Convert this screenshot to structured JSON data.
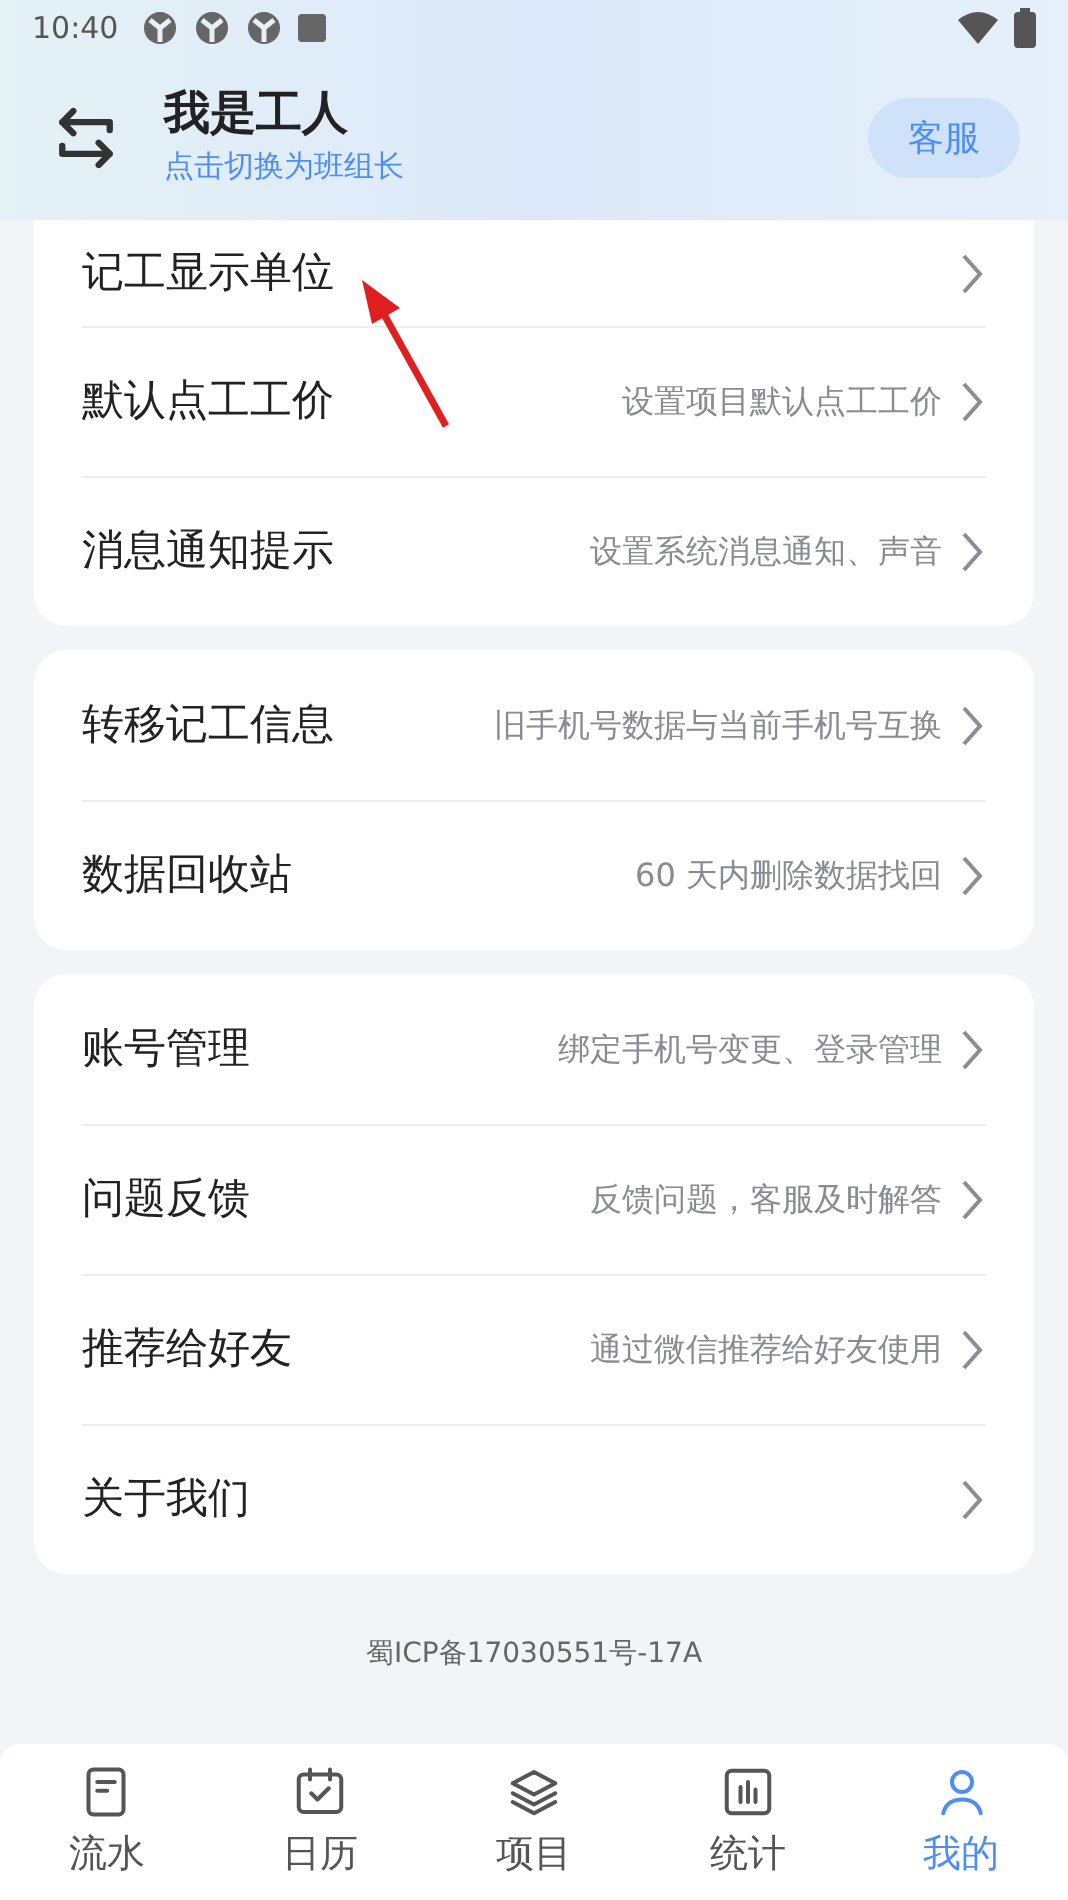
{
  "status_bar": {
    "time": "10:40"
  },
  "header": {
    "title": "我是工人",
    "subtitle": "点击切换为班组长",
    "service_button": "客服"
  },
  "groups": [
    {
      "items": [
        {
          "label": "记工显示单位"
        },
        {
          "label": "默认点工工价",
          "hint": "设置项目默认点工工价"
        },
        {
          "label": "消息通知提示",
          "hint": "设置系统消息通知、声音"
        }
      ]
    },
    {
      "items": [
        {
          "label": "转移记工信息",
          "hint": "旧手机号数据与当前手机号互换"
        },
        {
          "label": "数据回收站",
          "hint": "60 天内删除数据找回"
        }
      ]
    },
    {
      "items": [
        {
          "label": "账号管理",
          "hint": "绑定手机号变更、登录管理"
        },
        {
          "label": "问题反馈",
          "hint": "反馈问题，客服及时解答"
        },
        {
          "label": "推荐给好友",
          "hint": "通过微信推荐给好友使用"
        },
        {
          "label": "关于我们"
        }
      ]
    }
  ],
  "footer": "蜀ICP备17030551号-17A",
  "tabs": [
    {
      "label": "流水",
      "kind": "list",
      "selected": false
    },
    {
      "label": "日历",
      "kind": "calendar",
      "selected": false
    },
    {
      "label": "项目",
      "kind": "layers",
      "selected": false
    },
    {
      "label": "统计",
      "kind": "chart",
      "selected": false
    },
    {
      "label": "我的",
      "kind": "person",
      "selected": true
    }
  ]
}
